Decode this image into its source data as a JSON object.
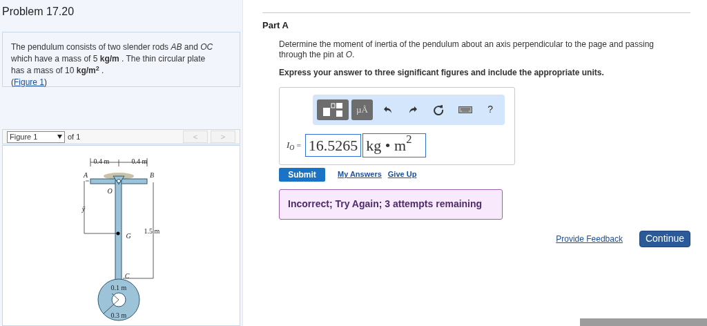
{
  "problem": {
    "title": "Problem 17.20",
    "statement": "The pendulum consists of two slender rods *AB* and *OC* which have a mass of 5 **kg/m** . The thin circular plate has a mass of 10 **kg/m$^{2}$** .",
    "figure_link_open": "(",
    "figure_link": "Figure 1",
    "figure_link_close": ")"
  },
  "figure": {
    "selector": "Figure 1",
    "of": "of 1",
    "prev": "<",
    "next": ">",
    "labels": [
      "0.4 m",
      "0.4 m",
      "A",
      "B",
      "O",
      "ȳ",
      "G",
      "1.5 m",
      "C",
      "0.1 m",
      "0.3 m"
    ]
  },
  "part": {
    "title": "Part A",
    "question": "Determine the moment of inertia of the pendulum about an axis perpendicular to the page and passing through the pin at *O*.",
    "instruction": "Express your answer to three significant figures and include the appropriate units."
  },
  "toolbar": {
    "units_button": "µÅ",
    "help": "?"
  },
  "answer": {
    "label": "I$_{O}$",
    "equals": "=",
    "value": "16.5265",
    "unit": "kg • m$^{2}$"
  },
  "actions": {
    "submit": "Submit",
    "links": [
      "My Answers",
      "Give Up"
    ]
  },
  "feedback": {
    "message": "Incorrect; Try Again; 3 attempts remaining"
  },
  "footer": {
    "feedback_link": "Provide Feedback",
    "continue": "Continue"
  }
}
